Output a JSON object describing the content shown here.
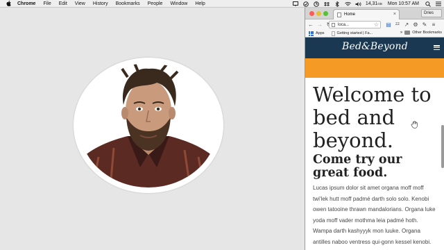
{
  "menubar": {
    "app_name": "Chrome",
    "menus": [
      "File",
      "Edit",
      "View",
      "History",
      "Bookmarks",
      "People",
      "Window",
      "Help"
    ],
    "status_icons": [
      "display-icon",
      "check-circle-icon",
      "refresh-icon",
      "dropbox-icon",
      "bluetooth-icon",
      "wifi-icon",
      "volume-icon"
    ],
    "memory": "14,31",
    "memory_unit": "GB",
    "clock": "Mon 10:57 AM"
  },
  "browser": {
    "tab_title": "Home",
    "user_name": "Dries",
    "address": "loca...",
    "bookmarks": {
      "apps_label": "Apps",
      "items": [
        "Getting started | Fa..."
      ],
      "other_label": "Other Bookmarks"
    }
  },
  "site": {
    "logo": "Bed&Beyond",
    "heading": "Welcome to bed and beyond.",
    "subheading": "Come try our great food.",
    "body": "Lucas ipsum dolor sit amet organa moff moff twi'lek hutt moff padmé darth solo solo. Kenobi owen tatooine thrawn mandalorians. Organa luke yoda moff vader mothma leia padmé hoth. Wampa darth kashyyyk mon luuke. Organa antilles naboo ventress qui-gonn kessel kenobi."
  },
  "colors": {
    "site_header": "#1a3852",
    "orange_band": "#f59b25",
    "desktop_bg": "#e6e6e6"
  }
}
